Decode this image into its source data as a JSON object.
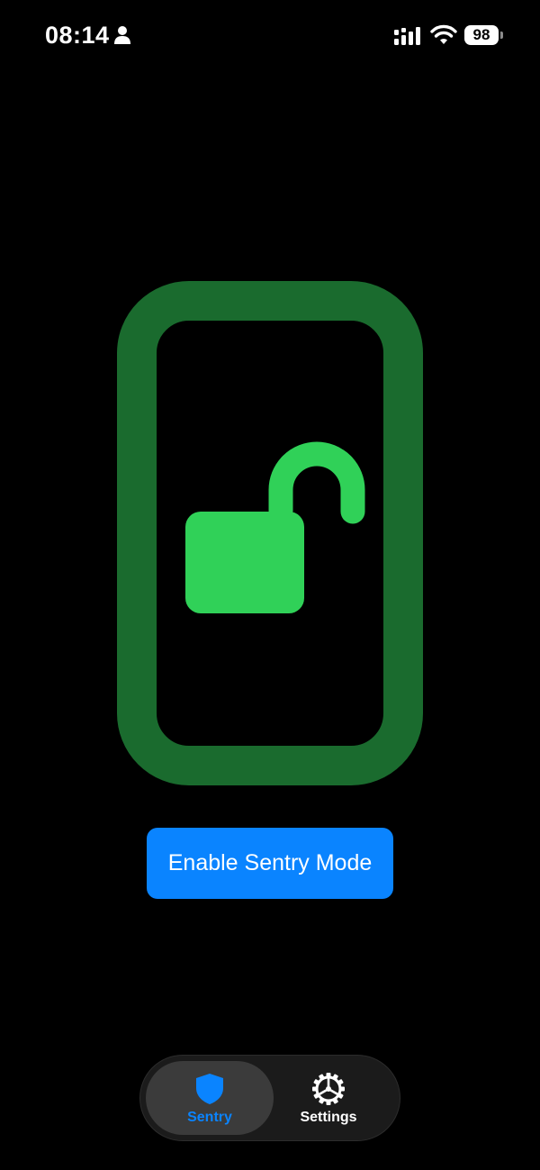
{
  "status_bar": {
    "time": "08:14",
    "battery_level": "98",
    "icons": [
      "person-icon",
      "cellular-signal-icon",
      "wifi-icon",
      "battery-icon"
    ]
  },
  "illustration": {
    "icon": "unlocked-padlock-icon",
    "frame_color": "#1a6b2e",
    "lock_color": "#30d158"
  },
  "main": {
    "enable_button_label": "Enable Sentry Mode"
  },
  "tab_bar": {
    "tabs": [
      {
        "label": "Sentry",
        "icon": "shield-icon",
        "selected": true
      },
      {
        "label": "Settings",
        "icon": "gear-icon",
        "selected": false
      }
    ]
  },
  "colors": {
    "accent": "#0a84ff",
    "background": "#000000"
  }
}
